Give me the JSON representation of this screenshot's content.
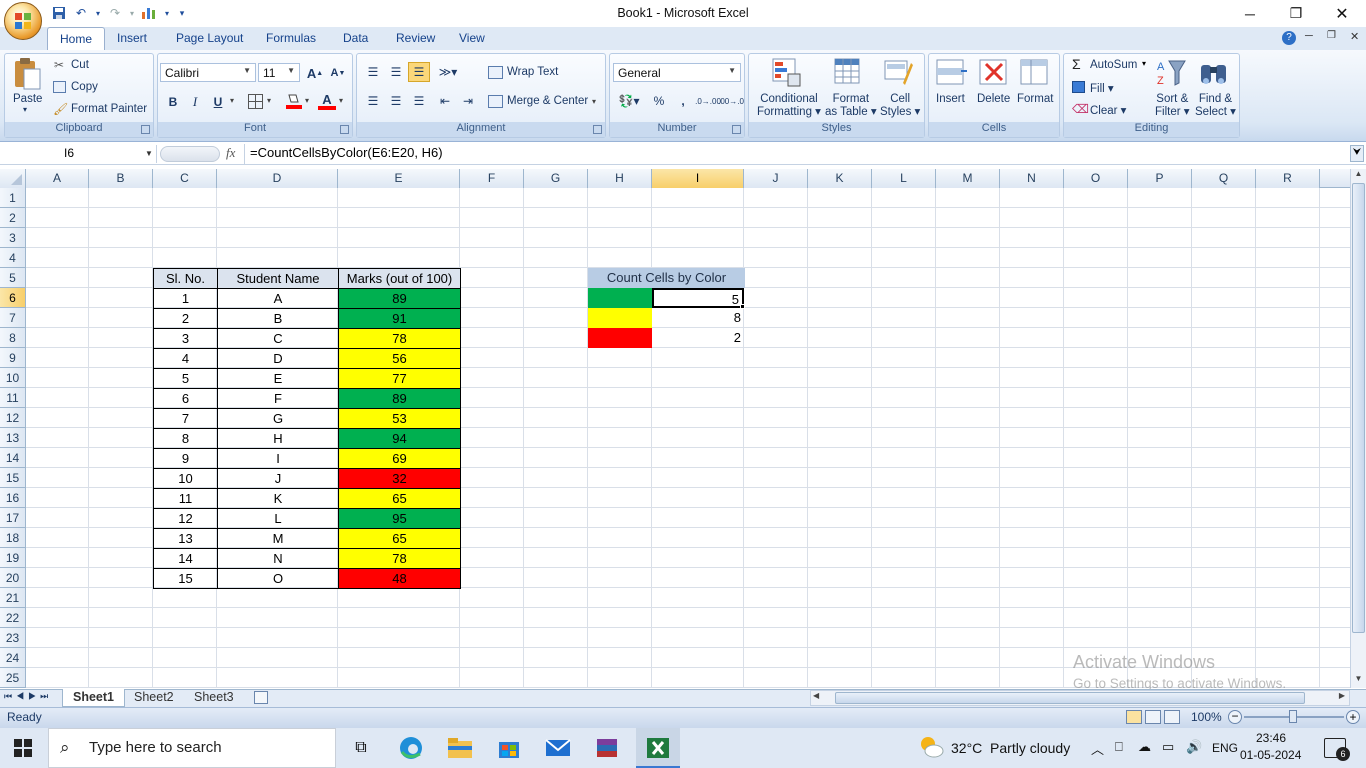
{
  "window": {
    "title": "Book1 - Microsoft Excel"
  },
  "tabs": [
    "Home",
    "Insert",
    "Page Layout",
    "Formulas",
    "Data",
    "Review",
    "View"
  ],
  "ribbon": {
    "clipboard": {
      "paste": "Paste",
      "cut": "Cut",
      "copy": "Copy",
      "format_painter": "Format Painter",
      "label": "Clipboard"
    },
    "font": {
      "name": "Calibri",
      "size": "11",
      "bold": "B",
      "italic": "I",
      "underline": "U",
      "grow": "A",
      "shrink": "A",
      "font_color": "A",
      "label": "Font"
    },
    "alignment": {
      "wrap": "Wrap Text",
      "merge": "Merge & Center",
      "label": "Alignment"
    },
    "number": {
      "format": "General",
      "percent": "%",
      "comma": ",",
      "inc": ".0→.00",
      "dec": ".00→.0",
      "label": "Number"
    },
    "styles": {
      "cond1": "Conditional",
      "cond2": "Formatting",
      "fmt1": "Format",
      "fmt2": "as Table",
      "cell1": "Cell",
      "cell2": "Styles",
      "label": "Styles"
    },
    "cells": {
      "insert": "Insert",
      "delete": "Delete",
      "format": "Format",
      "label": "Cells"
    },
    "editing": {
      "autosum": "AutoSum",
      "fill": "Fill",
      "clear": "Clear",
      "sort1": "Sort &",
      "sort2": "Filter",
      "find1": "Find &",
      "find2": "Select",
      "label": "Editing"
    }
  },
  "formula_bar": {
    "name_box": "I6",
    "fx": "fx",
    "formula": "=CountCellsByColor(E6:E20, H6)"
  },
  "columns": [
    "A",
    "B",
    "C",
    "D",
    "E",
    "F",
    "G",
    "H",
    "I",
    "J",
    "K",
    "L",
    "M",
    "N",
    "O",
    "P",
    "Q",
    "R"
  ],
  "rows": [
    "1",
    "2",
    "3",
    "4",
    "5",
    "6",
    "7",
    "8",
    "9",
    "10",
    "11",
    "12",
    "13",
    "14",
    "15",
    "16",
    "17",
    "18",
    "19",
    "20",
    "21",
    "22",
    "23",
    "24",
    "25"
  ],
  "table": {
    "headers": [
      "Sl. No.",
      "Student Name",
      "Marks (out of 100)"
    ],
    "rows": [
      {
        "n": "1",
        "name": "A",
        "marks": "89",
        "color": "green"
      },
      {
        "n": "2",
        "name": "B",
        "marks": "91",
        "color": "green"
      },
      {
        "n": "3",
        "name": "C",
        "marks": "78",
        "color": "yellow"
      },
      {
        "n": "4",
        "name": "D",
        "marks": "56",
        "color": "yellow"
      },
      {
        "n": "5",
        "name": "E",
        "marks": "77",
        "color": "yellow"
      },
      {
        "n": "6",
        "name": "F",
        "marks": "89",
        "color": "green"
      },
      {
        "n": "7",
        "name": "G",
        "marks": "53",
        "color": "yellow"
      },
      {
        "n": "8",
        "name": "H",
        "marks": "94",
        "color": "green"
      },
      {
        "n": "9",
        "name": "I",
        "marks": "69",
        "color": "yellow"
      },
      {
        "n": "10",
        "name": "J",
        "marks": "32",
        "color": "red"
      },
      {
        "n": "11",
        "name": "K",
        "marks": "65",
        "color": "yellow"
      },
      {
        "n": "12",
        "name": "L",
        "marks": "95",
        "color": "green"
      },
      {
        "n": "13",
        "name": "M",
        "marks": "65",
        "color": "yellow"
      },
      {
        "n": "14",
        "name": "N",
        "marks": "78",
        "color": "yellow"
      },
      {
        "n": "15",
        "name": "O",
        "marks": "48",
        "color": "red"
      }
    ]
  },
  "count_table": {
    "header": "Count Cells by Color",
    "rows": [
      {
        "color": "green",
        "count": "5"
      },
      {
        "color": "yellow",
        "count": "8"
      },
      {
        "color": "red",
        "count": "2"
      }
    ]
  },
  "colors": {
    "green": "#00b050",
    "yellow": "#ffff00",
    "red": "#ff0000"
  },
  "sheets": [
    "Sheet1",
    "Sheet2",
    "Sheet3"
  ],
  "status": {
    "ready": "Ready",
    "zoom": "100%"
  },
  "watermark": {
    "line1": "Activate Windows",
    "line2": "Go to Settings to activate Windows."
  },
  "taskbar": {
    "search": "Type here to search",
    "weather": "32°C  Partly cloudy",
    "lang": "ENG",
    "time": "23:46",
    "date": "01-05-2024",
    "notif": "6"
  }
}
